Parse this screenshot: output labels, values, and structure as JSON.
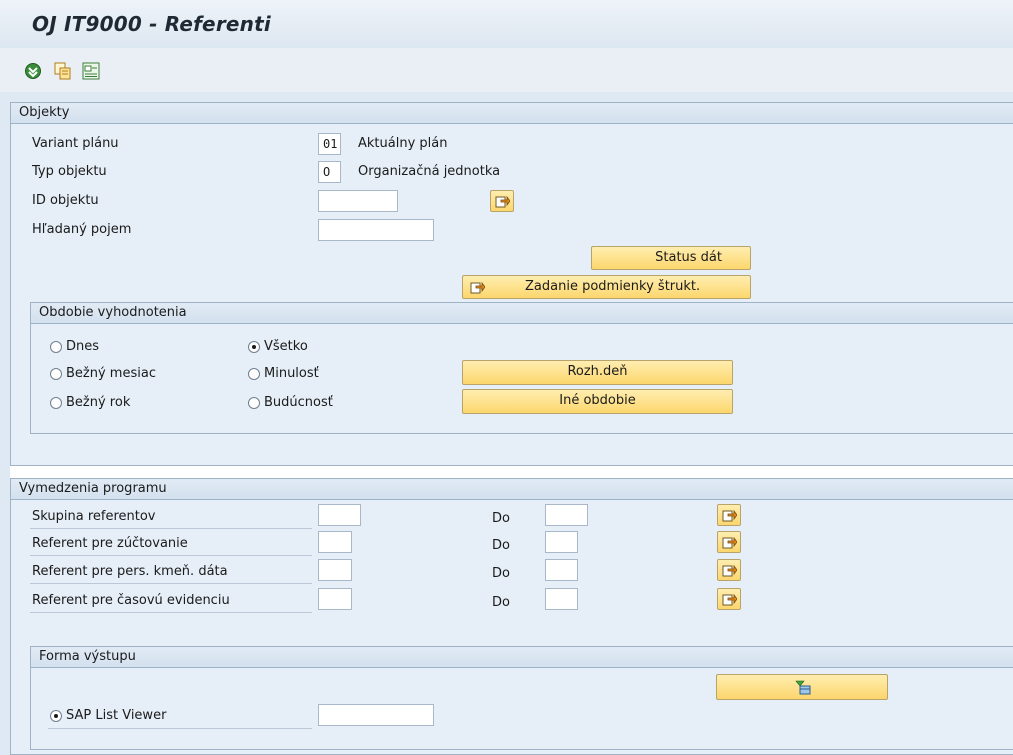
{
  "window": {
    "title": "OJ IT9000 - Referenti"
  },
  "toolbar": {
    "icons": [
      "execute-icon",
      "copy-variant-icon",
      "selection-options-icon"
    ]
  },
  "objekty": {
    "header": "Objekty",
    "variant_label": "Variant plánu",
    "variant_value": "01",
    "variant_text": "Aktuálny plán",
    "typ_label": "Typ objektu",
    "typ_value": "O",
    "typ_text": "Organizačná jednotka",
    "id_label": "ID objektu",
    "id_value": "",
    "search_label": "Hľadaný pojem",
    "search_value": "",
    "status_button": "Status dát",
    "struct_button": "Zadanie podmienky štrukt."
  },
  "obdobie": {
    "header": "Obdobie vyhodnotenia",
    "radios": [
      {
        "label": "Dnes",
        "selected": false
      },
      {
        "label": "Bežný mesiac",
        "selected": false
      },
      {
        "label": "Bežný rok",
        "selected": false
      },
      {
        "label": "Všetko",
        "selected": true
      },
      {
        "label": "Minulosť",
        "selected": false
      },
      {
        "label": "Budúcnosť",
        "selected": false
      }
    ],
    "rozh_button": "Rozh.deň",
    "ine_button": "Iné obdobie"
  },
  "vymedzenia": {
    "header": "Vymedzenia programu",
    "to_label": "Do",
    "rows": [
      {
        "label": "Skupina referentov",
        "from": "",
        "to": ""
      },
      {
        "label": "Referent pre zúčtovanie",
        "from": "",
        "to": ""
      },
      {
        "label": "Referent pre pers. kmeň. dáta",
        "from": "",
        "to": ""
      },
      {
        "label": "Referent pre časovú evidenciu",
        "from": "",
        "to": ""
      }
    ]
  },
  "forma": {
    "header": "Forma výstupu",
    "radio_label": "SAP List Viewer",
    "radio_selected": true,
    "layout_value": ""
  },
  "colors": {
    "button_yellow": "#fcd66d",
    "group_bg": "#e6eef7",
    "group_border": "#9fb2c6"
  }
}
